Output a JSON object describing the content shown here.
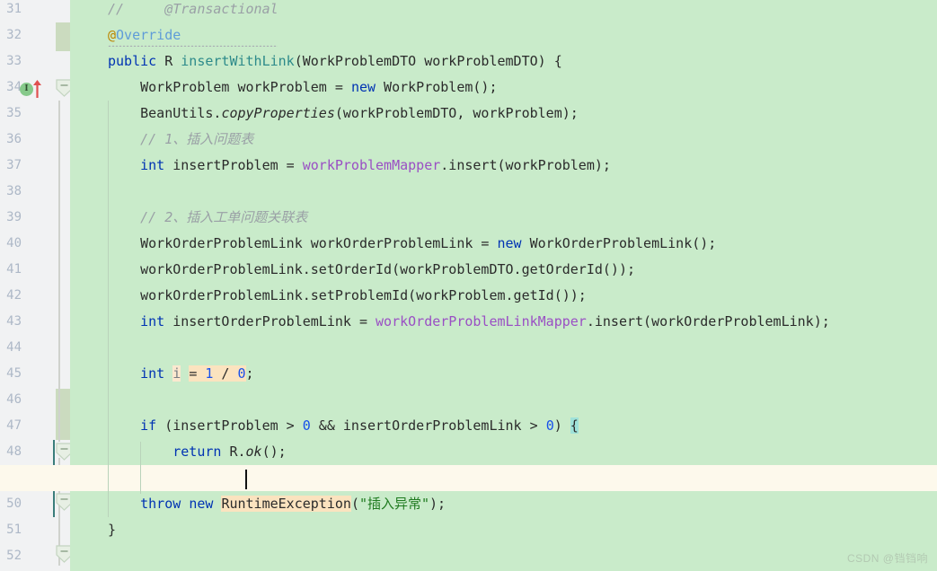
{
  "editor": {
    "theme_bg": "#c9ebca",
    "gutter_bg": "#f1f2f3",
    "current_line_bg": "#fdf9ec",
    "search_highlight": "#fbe3bf",
    "brace_highlight": "#9fe2d9",
    "line_numbers": [
      "31",
      "32",
      "33",
      "34",
      "35",
      "36",
      "37",
      "38",
      "39",
      "40",
      "41",
      "42",
      "43",
      "44",
      "45",
      "46",
      "47",
      "48",
      "49",
      "50",
      "51",
      "52"
    ],
    "gutter_icons": {
      "implementation_marker": "I",
      "implementation_icon": "implemented-method-icon",
      "override_arrow_icon": "override-up-arrow-icon",
      "fold_icon": "fold-collapse-icon"
    },
    "lines": [
      {
        "n": 1,
        "indent": 0,
        "tokens": [
          {
            "t": "//     @Transactional",
            "c": "cmt"
          }
        ]
      },
      {
        "n": 2,
        "indent": 0,
        "tokens": [
          {
            "t": "@",
            "c": "at"
          },
          {
            "t": "Override",
            "c": "anno"
          }
        ]
      },
      {
        "n": 3,
        "indent": 0,
        "tokens": [
          {
            "t": "public",
            "c": "kw"
          },
          {
            "t": " R ",
            "c": "ident"
          },
          {
            "t": "insertWithLink",
            "c": "method"
          },
          {
            "t": "(WorkProblemDTO workProblemDTO) {",
            "c": "ident"
          }
        ]
      },
      {
        "n": 4,
        "indent": 1,
        "tokens": [
          {
            "t": "WorkProblem workProblem = ",
            "c": "ident"
          },
          {
            "t": "new",
            "c": "kw"
          },
          {
            "t": " WorkProblem();",
            "c": "ident"
          }
        ]
      },
      {
        "n": 5,
        "indent": 1,
        "tokens": [
          {
            "t": "BeanUtils.",
            "c": "ident"
          },
          {
            "t": "copyProperties",
            "c": "italic"
          },
          {
            "t": "(workProblemDTO, workProblem);",
            "c": "ident"
          }
        ]
      },
      {
        "n": 6,
        "indent": 1,
        "tokens": [
          {
            "t": "// 1、插入问题表",
            "c": "cmt"
          }
        ]
      },
      {
        "n": 7,
        "indent": 1,
        "tokens": [
          {
            "t": "int",
            "c": "kw"
          },
          {
            "t": " insertProblem = ",
            "c": "ident"
          },
          {
            "t": "workProblemMapper",
            "c": "field"
          },
          {
            "t": ".insert(workProblem);",
            "c": "ident"
          }
        ]
      },
      {
        "n": 8,
        "indent": 1,
        "tokens": []
      },
      {
        "n": 9,
        "indent": 1,
        "tokens": [
          {
            "t": "// 2、插入工单问题关联表",
            "c": "cmt"
          }
        ]
      },
      {
        "n": 10,
        "indent": 1,
        "tokens": [
          {
            "t": "WorkOrderProblemLink workOrderProblemLink = ",
            "c": "ident"
          },
          {
            "t": "new",
            "c": "kw"
          },
          {
            "t": " WorkOrderProblemLink();",
            "c": "ident"
          }
        ]
      },
      {
        "n": 11,
        "indent": 1,
        "tokens": [
          {
            "t": "workOrderProblemLink.setOrderId(workProblemDTO.getOrderId());",
            "c": "ident"
          }
        ]
      },
      {
        "n": 12,
        "indent": 1,
        "tokens": [
          {
            "t": "workOrderProblemLink.setProblemId(workProblem.getId());",
            "c": "ident"
          }
        ]
      },
      {
        "n": 13,
        "indent": 1,
        "tokens": [
          {
            "t": "int",
            "c": "kw"
          },
          {
            "t": " insertOrderProblemLink = ",
            "c": "ident"
          },
          {
            "t": "workOrderProblemLinkMapper",
            "c": "field"
          },
          {
            "t": ".insert(workOrderProblemLink);",
            "c": "ident"
          }
        ]
      },
      {
        "n": 14,
        "indent": 1,
        "tokens": []
      },
      {
        "n": 15,
        "indent": 1,
        "tokens": [
          {
            "t": "int",
            "c": "kw"
          },
          {
            "t": " ",
            "c": "ident"
          },
          {
            "t": "i",
            "c": "localvar",
            "hl": "ident"
          },
          {
            "t": " ",
            "c": "ident"
          },
          {
            "t": "= ",
            "c": "ident",
            "hl": "search"
          },
          {
            "t": "1",
            "c": "num",
            "hl": "search"
          },
          {
            "t": " / ",
            "c": "ident",
            "hl": "search"
          },
          {
            "t": "0",
            "c": "num",
            "hl": "search"
          },
          {
            "t": ";",
            "c": "ident"
          }
        ]
      },
      {
        "n": 16,
        "indent": 1,
        "tokens": []
      },
      {
        "n": 17,
        "indent": 1,
        "tokens": [
          {
            "t": "if",
            "c": "kw"
          },
          {
            "t": " (insertProblem > ",
            "c": "ident"
          },
          {
            "t": "0",
            "c": "num"
          },
          {
            "t": " && insertOrderProblemLink > ",
            "c": "ident"
          },
          {
            "t": "0",
            "c": "num"
          },
          {
            "t": ") ",
            "c": "ident"
          },
          {
            "t": "{",
            "c": "ident",
            "hl": "brace"
          }
        ]
      },
      {
        "n": 18,
        "indent": 2,
        "tokens": [
          {
            "t": "return",
            "c": "kw"
          },
          {
            "t": " R.",
            "c": "ident"
          },
          {
            "t": "ok",
            "c": "italic"
          },
          {
            "t": "();",
            "c": "ident"
          }
        ]
      },
      {
        "n": 19,
        "indent": 1,
        "current": true,
        "tokens": [
          {
            "t": "}",
            "c": "ident",
            "hl": "brace"
          }
        ]
      },
      {
        "n": 20,
        "indent": 1,
        "tokens": [
          {
            "t": "throw",
            "c": "kw"
          },
          {
            "t": " ",
            "c": "ident"
          },
          {
            "t": "new",
            "c": "kw"
          },
          {
            "t": " ",
            "c": "ident"
          },
          {
            "t": "RuntimeException",
            "c": "ident",
            "hl": "search"
          },
          {
            "t": "(",
            "c": "ident"
          },
          {
            "t": "\"插入异常\"",
            "c": "str"
          },
          {
            "t": ");",
            "c": "ident"
          }
        ]
      },
      {
        "n": 21,
        "indent": 0,
        "tokens": [
          {
            "t": "}",
            "c": "ident"
          }
        ]
      }
    ]
  },
  "watermark": {
    "text": "CSDN @铛铛响"
  }
}
